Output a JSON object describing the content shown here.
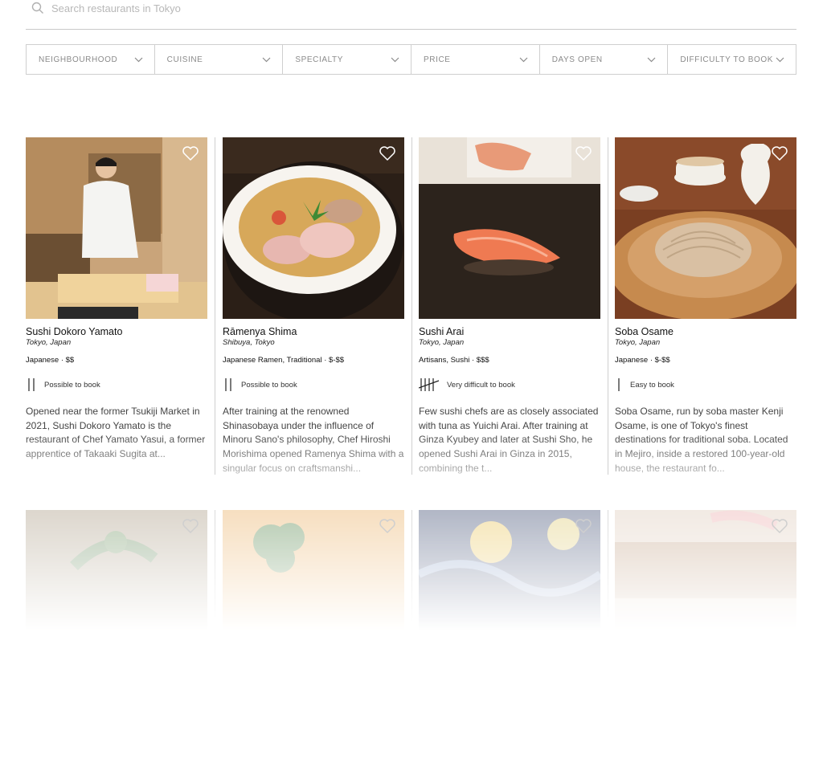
{
  "search": {
    "placeholder": "Search restaurants in Tokyo"
  },
  "filters": [
    "NEIGHBOURHOOD",
    "CUISINE",
    "SPECIALTY",
    "PRICE",
    "DAYS OPEN",
    "DIFFICULTY TO BOOK"
  ],
  "restaurants": [
    {
      "name": "Sushi Dokoro Yamato",
      "location": "Tokyo, Japan",
      "category": "Japanese · $$",
      "difficulty": "Possible to book",
      "difficulty_level": 2,
      "description": "Opened near the former Tsukiji Market in 2021, Sushi Dokoro Yamato is the restaurant of Chef Yamato Yasui, a former apprentice of Takaaki Sugita at..."
    },
    {
      "name": "Rāmenya Shima",
      "location": "Shibuya, Tokyo",
      "category": "Japanese Ramen, Traditional · $-$$",
      "difficulty": "Possible to book",
      "difficulty_level": 2,
      "description": "After training at the renowned Shinasobaya under the influence of Minoru Sano's philosophy, Chef Hiroshi Morishima opened Ramenya Shima with a singular focus on craftsmanshi..."
    },
    {
      "name": "Sushi Arai",
      "location": "Tokyo, Japan",
      "category": "Artisans, Sushi · $$$",
      "difficulty": "Very difficult to book",
      "difficulty_level": 5,
      "description": "Few sushi chefs are as closely associated with tuna as Yuichi Arai. After training at Ginza Kyubey and later at Sushi Sho, he opened Sushi Arai in Ginza in 2015, combining the t..."
    },
    {
      "name": "Soba Osame",
      "location": "Tokyo, Japan",
      "category": "Japanese · $-$$",
      "difficulty": "Easy to book",
      "difficulty_level": 1,
      "description": "Soba Osame, run by soba master Kenji Osame, is one of Tokyo's finest destinations for traditional soba. Located in Mejiro, inside a restored 100-year-old house, the restaurant fo..."
    }
  ],
  "icons": {
    "search": "search-icon",
    "favorite": "heart-icon",
    "dropdown": "chevron-down-icon",
    "difficulty": "tally-icon"
  },
  "colors": {
    "text": "#111111",
    "muted": "#8a8a8a",
    "border": "#cfcfcf"
  }
}
